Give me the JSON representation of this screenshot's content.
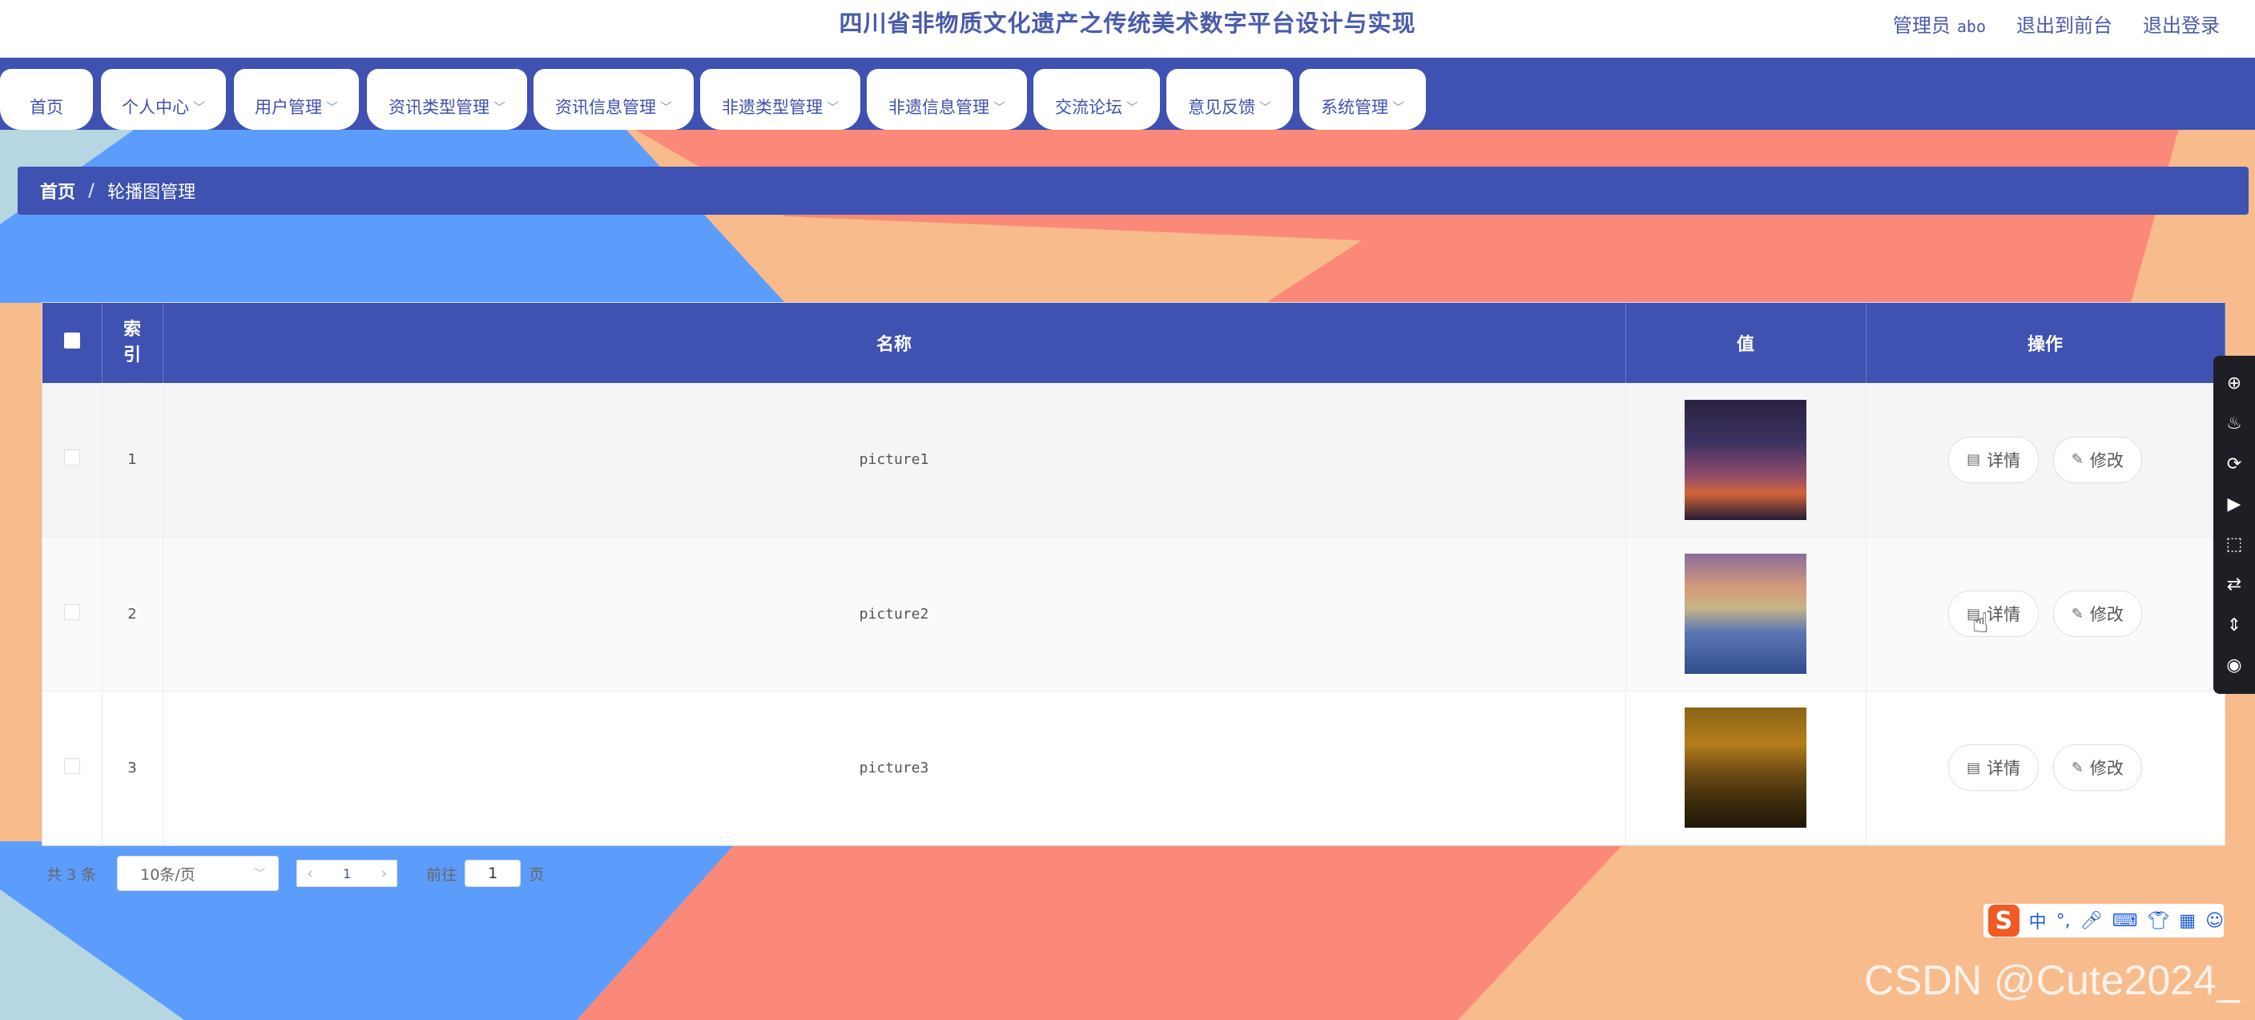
{
  "header": {
    "title": "四川省非物质文化遗产之传统美术数字平台设计与实现",
    "role_label": "管理员",
    "user_name": "abo",
    "front_label": "退出到前台",
    "logout_label": "退出登录"
  },
  "nav": {
    "items": [
      {
        "label": "首页",
        "has_dropdown": false
      },
      {
        "label": "个人中心",
        "has_dropdown": true
      },
      {
        "label": "用户管理",
        "has_dropdown": true
      },
      {
        "label": "资讯类型管理",
        "has_dropdown": true
      },
      {
        "label": "资讯信息管理",
        "has_dropdown": true
      },
      {
        "label": "非遗类型管理",
        "has_dropdown": true
      },
      {
        "label": "非遗信息管理",
        "has_dropdown": true
      },
      {
        "label": "交流论坛",
        "has_dropdown": true
      },
      {
        "label": "意见反馈",
        "has_dropdown": true
      },
      {
        "label": "系统管理",
        "has_dropdown": true
      }
    ]
  },
  "breadcrumb": {
    "home": "首页",
    "separator": "/",
    "current": "轮播图管理"
  },
  "table": {
    "columns": [
      "索引",
      "名称",
      "值",
      "操作"
    ],
    "rows": [
      {
        "index": "1",
        "name": "picture1"
      },
      {
        "index": "2",
        "name": "picture2"
      },
      {
        "index": "3",
        "name": "picture3"
      }
    ],
    "detail_label": "详情",
    "edit_label": "修改"
  },
  "pagination": {
    "total_text": "共 3 条",
    "page_size": "10条/页",
    "current_page": "1",
    "goto_label": "前往",
    "goto_value": "1",
    "page_suffix": "页"
  },
  "ime": {
    "logo": "S",
    "lang": "中"
  },
  "watermark": "CSDN @Cute2024_",
  "colors": {
    "primary": "#3f51b1",
    "bg_blue": "#5c9dfb",
    "bg_peach": "#f8bb8c",
    "bg_salmon": "#fb8979",
    "bg_lightblue": "#b6d6e2"
  }
}
